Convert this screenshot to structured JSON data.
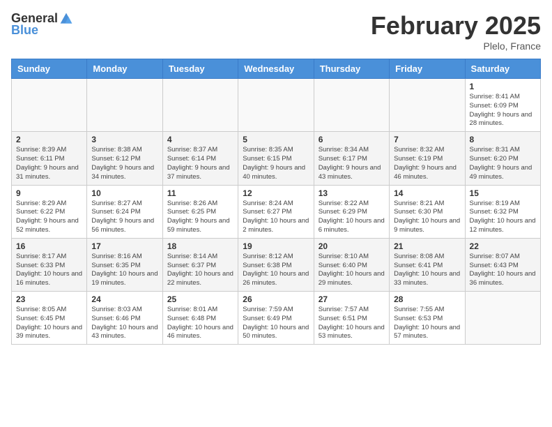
{
  "header": {
    "logo_general": "General",
    "logo_blue": "Blue",
    "month_title": "February 2025",
    "location": "Plelo, France"
  },
  "days_of_week": [
    "Sunday",
    "Monday",
    "Tuesday",
    "Wednesday",
    "Thursday",
    "Friday",
    "Saturday"
  ],
  "weeks": [
    {
      "days": [
        {
          "number": "",
          "info": ""
        },
        {
          "number": "",
          "info": ""
        },
        {
          "number": "",
          "info": ""
        },
        {
          "number": "",
          "info": ""
        },
        {
          "number": "",
          "info": ""
        },
        {
          "number": "",
          "info": ""
        },
        {
          "number": "1",
          "info": "Sunrise: 8:41 AM\nSunset: 6:09 PM\nDaylight: 9 hours and 28 minutes."
        }
      ]
    },
    {
      "days": [
        {
          "number": "2",
          "info": "Sunrise: 8:39 AM\nSunset: 6:11 PM\nDaylight: 9 hours and 31 minutes."
        },
        {
          "number": "3",
          "info": "Sunrise: 8:38 AM\nSunset: 6:12 PM\nDaylight: 9 hours and 34 minutes."
        },
        {
          "number": "4",
          "info": "Sunrise: 8:37 AM\nSunset: 6:14 PM\nDaylight: 9 hours and 37 minutes."
        },
        {
          "number": "5",
          "info": "Sunrise: 8:35 AM\nSunset: 6:15 PM\nDaylight: 9 hours and 40 minutes."
        },
        {
          "number": "6",
          "info": "Sunrise: 8:34 AM\nSunset: 6:17 PM\nDaylight: 9 hours and 43 minutes."
        },
        {
          "number": "7",
          "info": "Sunrise: 8:32 AM\nSunset: 6:19 PM\nDaylight: 9 hours and 46 minutes."
        },
        {
          "number": "8",
          "info": "Sunrise: 8:31 AM\nSunset: 6:20 PM\nDaylight: 9 hours and 49 minutes."
        }
      ]
    },
    {
      "days": [
        {
          "number": "9",
          "info": "Sunrise: 8:29 AM\nSunset: 6:22 PM\nDaylight: 9 hours and 52 minutes."
        },
        {
          "number": "10",
          "info": "Sunrise: 8:27 AM\nSunset: 6:24 PM\nDaylight: 9 hours and 56 minutes."
        },
        {
          "number": "11",
          "info": "Sunrise: 8:26 AM\nSunset: 6:25 PM\nDaylight: 9 hours and 59 minutes."
        },
        {
          "number": "12",
          "info": "Sunrise: 8:24 AM\nSunset: 6:27 PM\nDaylight: 10 hours and 2 minutes."
        },
        {
          "number": "13",
          "info": "Sunrise: 8:22 AM\nSunset: 6:29 PM\nDaylight: 10 hours and 6 minutes."
        },
        {
          "number": "14",
          "info": "Sunrise: 8:21 AM\nSunset: 6:30 PM\nDaylight: 10 hours and 9 minutes."
        },
        {
          "number": "15",
          "info": "Sunrise: 8:19 AM\nSunset: 6:32 PM\nDaylight: 10 hours and 12 minutes."
        }
      ]
    },
    {
      "days": [
        {
          "number": "16",
          "info": "Sunrise: 8:17 AM\nSunset: 6:33 PM\nDaylight: 10 hours and 16 minutes."
        },
        {
          "number": "17",
          "info": "Sunrise: 8:16 AM\nSunset: 6:35 PM\nDaylight: 10 hours and 19 minutes."
        },
        {
          "number": "18",
          "info": "Sunrise: 8:14 AM\nSunset: 6:37 PM\nDaylight: 10 hours and 22 minutes."
        },
        {
          "number": "19",
          "info": "Sunrise: 8:12 AM\nSunset: 6:38 PM\nDaylight: 10 hours and 26 minutes."
        },
        {
          "number": "20",
          "info": "Sunrise: 8:10 AM\nSunset: 6:40 PM\nDaylight: 10 hours and 29 minutes."
        },
        {
          "number": "21",
          "info": "Sunrise: 8:08 AM\nSunset: 6:41 PM\nDaylight: 10 hours and 33 minutes."
        },
        {
          "number": "22",
          "info": "Sunrise: 8:07 AM\nSunset: 6:43 PM\nDaylight: 10 hours and 36 minutes."
        }
      ]
    },
    {
      "days": [
        {
          "number": "23",
          "info": "Sunrise: 8:05 AM\nSunset: 6:45 PM\nDaylight: 10 hours and 39 minutes."
        },
        {
          "number": "24",
          "info": "Sunrise: 8:03 AM\nSunset: 6:46 PM\nDaylight: 10 hours and 43 minutes."
        },
        {
          "number": "25",
          "info": "Sunrise: 8:01 AM\nSunset: 6:48 PM\nDaylight: 10 hours and 46 minutes."
        },
        {
          "number": "26",
          "info": "Sunrise: 7:59 AM\nSunset: 6:49 PM\nDaylight: 10 hours and 50 minutes."
        },
        {
          "number": "27",
          "info": "Sunrise: 7:57 AM\nSunset: 6:51 PM\nDaylight: 10 hours and 53 minutes."
        },
        {
          "number": "28",
          "info": "Sunrise: 7:55 AM\nSunset: 6:53 PM\nDaylight: 10 hours and 57 minutes."
        },
        {
          "number": "",
          "info": ""
        }
      ]
    }
  ]
}
